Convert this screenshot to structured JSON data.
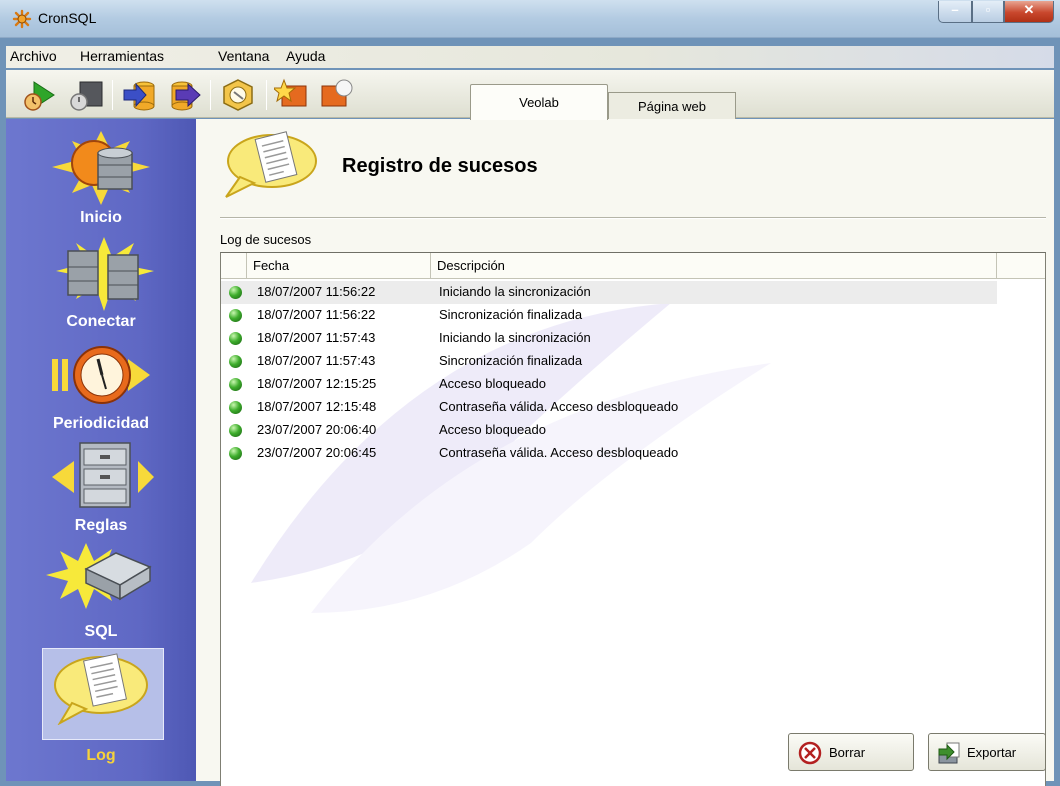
{
  "window": {
    "title": "CronSQL"
  },
  "menu": [
    "Archivo",
    "Herramientas",
    "Ventana",
    "Ayuda"
  ],
  "tabs": [
    {
      "label": "Veolab",
      "active": true
    },
    {
      "label": "Página web",
      "active": false
    }
  ],
  "sidebar": {
    "items": [
      {
        "label": "Inicio",
        "icon": "database-sun-icon",
        "selected": false
      },
      {
        "label": "Conectar",
        "icon": "connect-databases-icon",
        "selected": false
      },
      {
        "label": "Periodicidad",
        "icon": "clock-icon",
        "selected": false
      },
      {
        "label": "Reglas",
        "icon": "filing-cabinet-icon",
        "selected": false
      },
      {
        "label": "SQL",
        "icon": "sql-key-icon",
        "selected": false
      },
      {
        "label": "Log",
        "icon": "speech-document-icon",
        "selected": true
      }
    ]
  },
  "main": {
    "title": "Registro de sucesos",
    "group_label": "Log de sucesos",
    "columns": [
      "Fecha",
      "Descripción"
    ],
    "rows": [
      {
        "date": "18/07/2007 11:56:22",
        "description": "Iniciando la sincronización"
      },
      {
        "date": "18/07/2007 11:56:22",
        "description": "Sincronización finalizada"
      },
      {
        "date": "18/07/2007 11:57:43",
        "description": "Iniciando la sincronización"
      },
      {
        "date": "18/07/2007 11:57:43",
        "description": "Sincronización finalizada"
      },
      {
        "date": "18/07/2007 12:15:25",
        "description": "Acceso bloqueado"
      },
      {
        "date": "18/07/2007 12:15:48",
        "description": "Contraseña válida. Acceso desbloqueado"
      },
      {
        "date": "23/07/2007 20:06:40",
        "description": "Acceso bloqueado"
      },
      {
        "date": "23/07/2007 20:06:45",
        "description": "Contraseña válida. Acceso desbloqueado"
      }
    ],
    "buttons": {
      "delete": "Borrar",
      "export": "Exportar"
    }
  },
  "colors": {
    "sidebar": "#5f68c4",
    "sidebar_label": "#ffffff",
    "sidebar_selected_label": "#f6d23a",
    "status_ok": "#3fae2d"
  }
}
